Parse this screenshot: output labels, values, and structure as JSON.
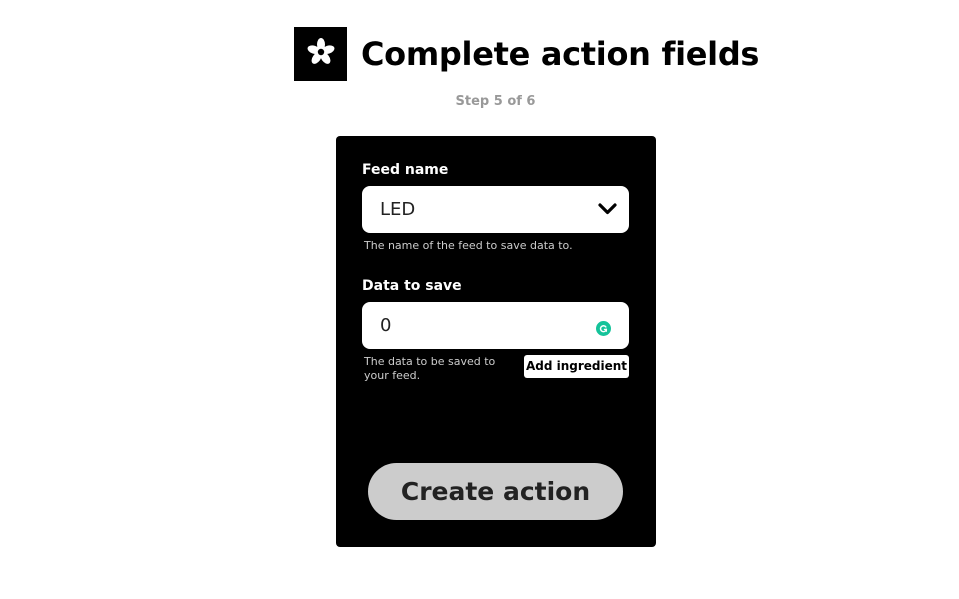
{
  "header": {
    "title": "Complete action fields",
    "step_text": "Step 5 of 6",
    "logo_icon": "adafruit-flower-icon"
  },
  "form": {
    "feed_name": {
      "label": "Feed name",
      "selected_value": "LED",
      "helper": "The name of the feed to save data to."
    },
    "data_to_save": {
      "label": "Data to save",
      "value": "0",
      "helper": "The data to be saved to your feed.",
      "add_ingredient_label": "Add ingredient"
    },
    "submit_label": "Create action"
  },
  "colors": {
    "card_background": "#000000",
    "button_background": "#cccccc",
    "grammarly_badge": "#15c39a"
  }
}
